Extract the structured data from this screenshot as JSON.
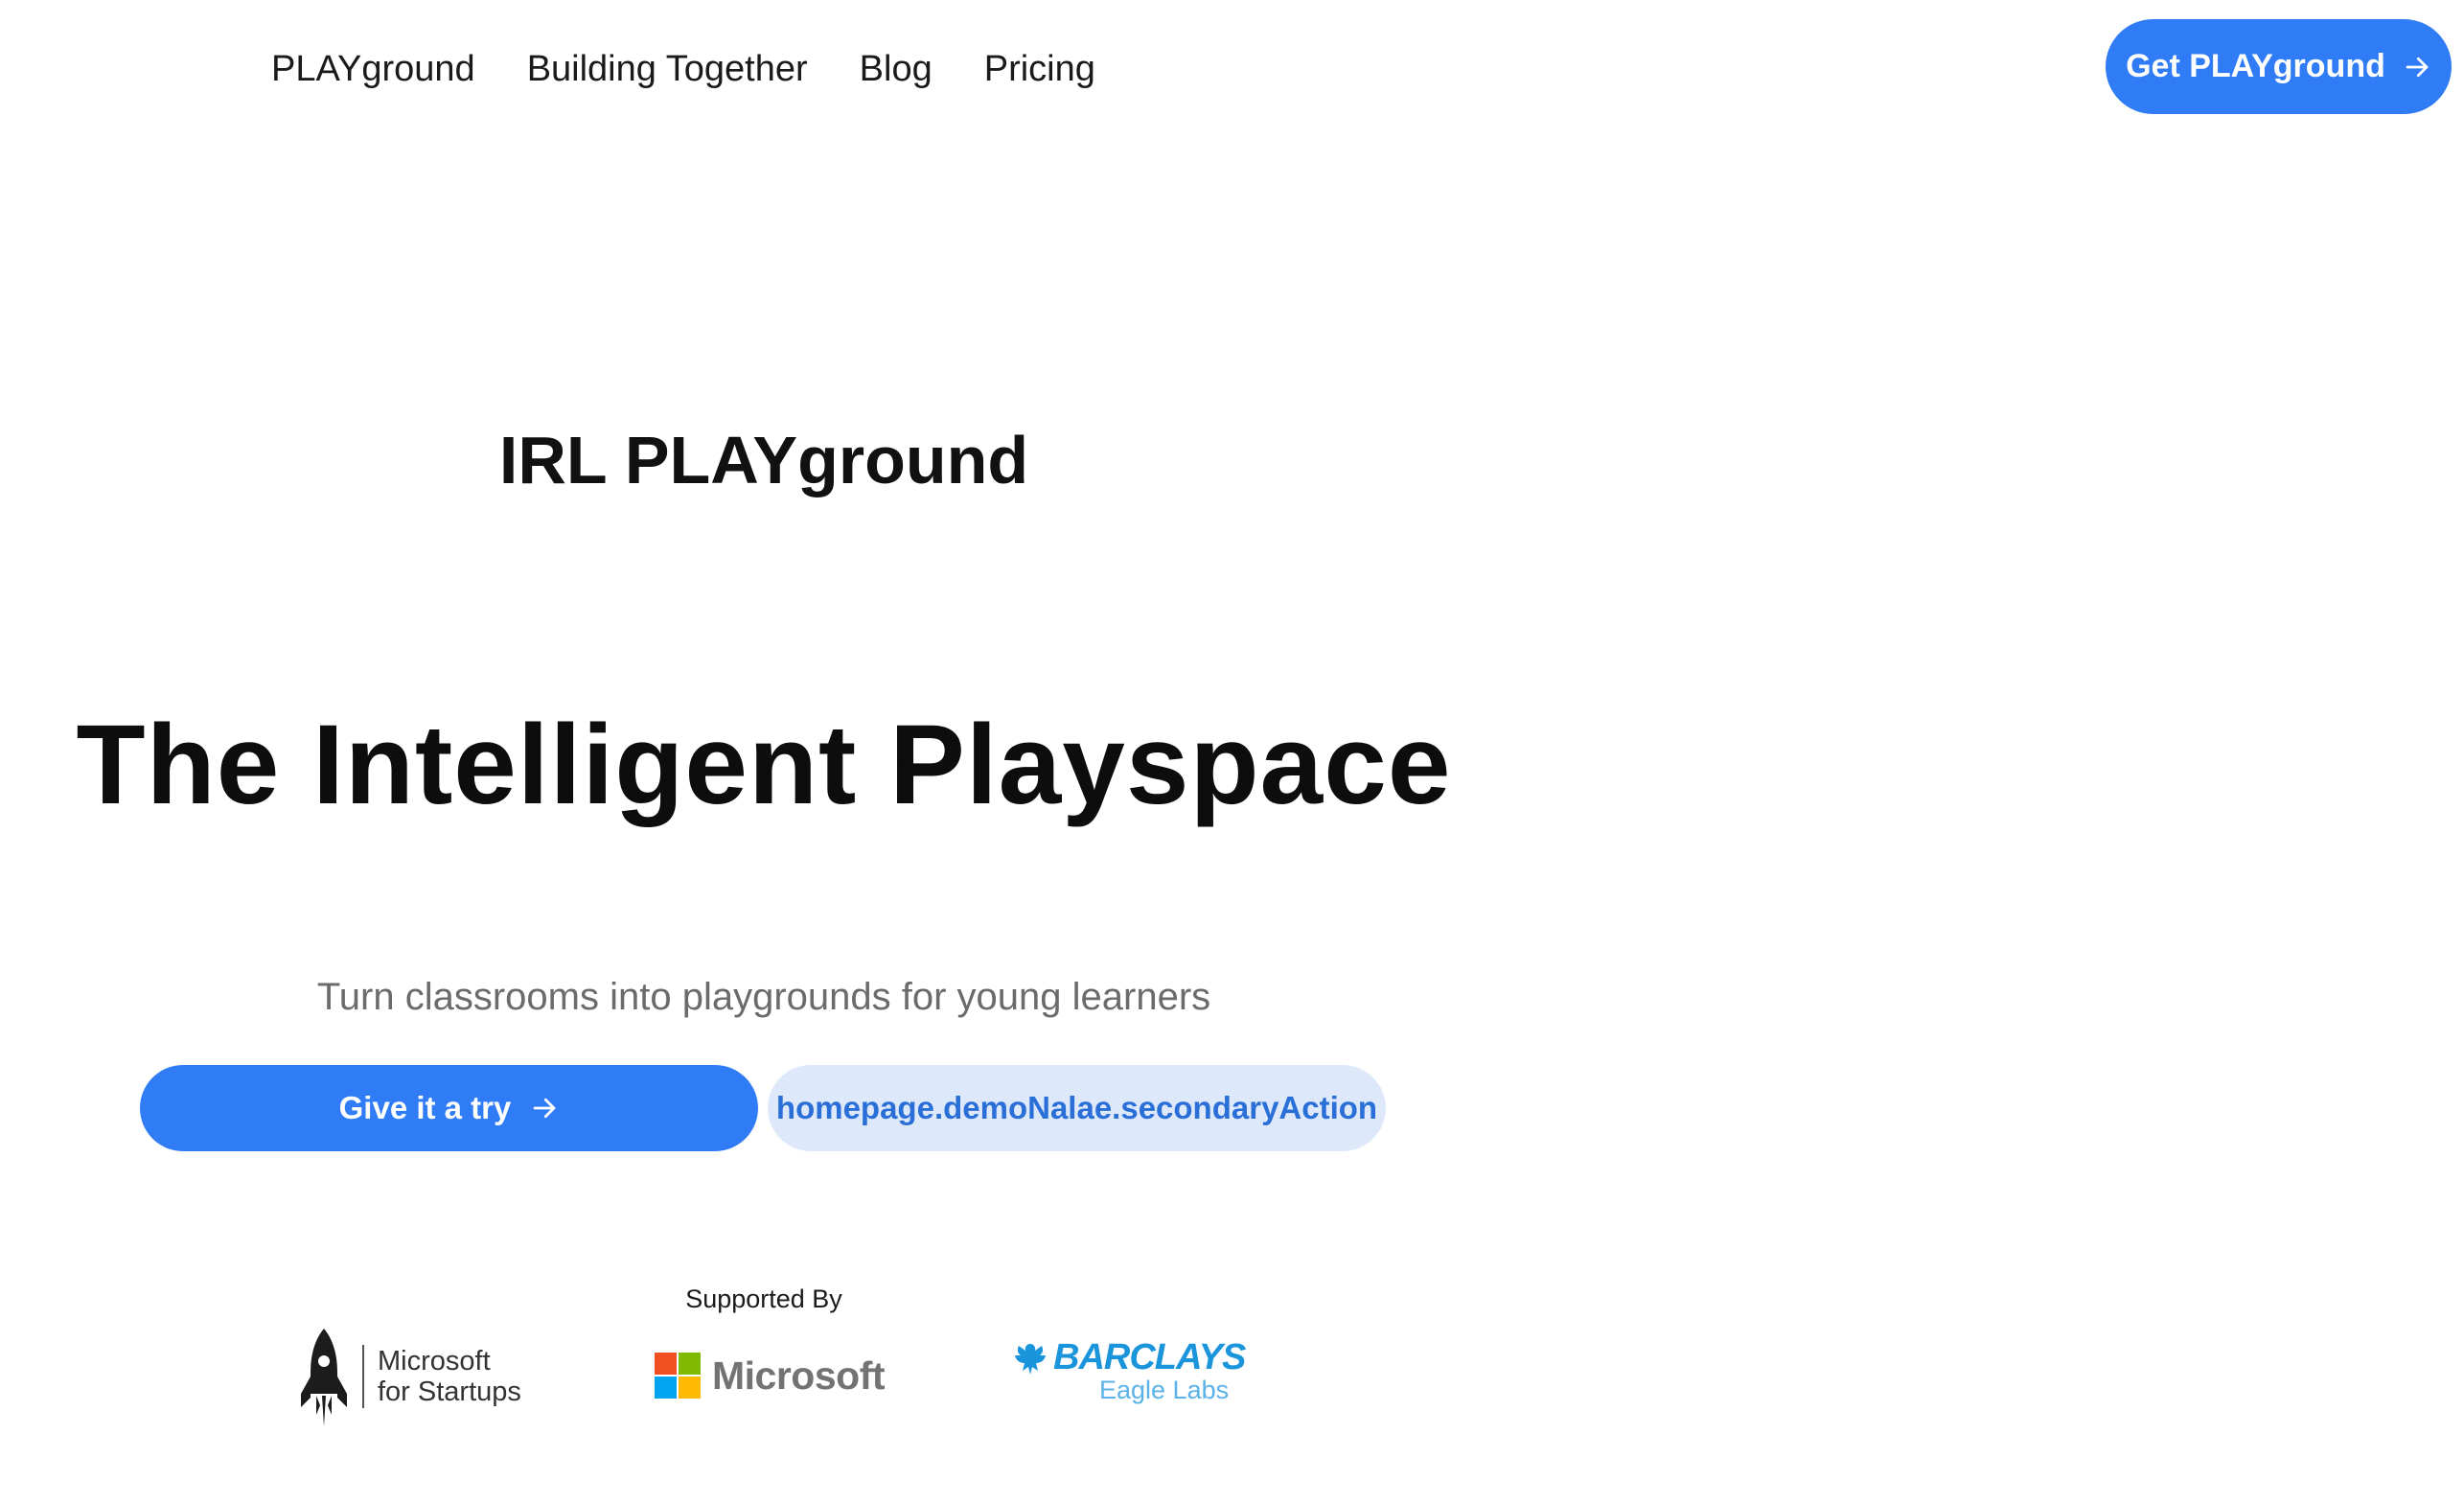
{
  "nav": {
    "items": [
      {
        "label": "PLAYground"
      },
      {
        "label": "Building Together"
      },
      {
        "label": "Blog"
      },
      {
        "label": "Pricing"
      }
    ],
    "cta_label": "Get PLAYground"
  },
  "hero": {
    "brand": "IRL PLAYground",
    "title": "The Intelligent Playspace",
    "subtitle": "Turn classrooms into playgrounds for young learners",
    "primary_action": "Give it a try",
    "secondary_action": "homepage.demoNalae.secondaryAction"
  },
  "supporters": {
    "heading": "Supported By",
    "logos": [
      {
        "icon": "rocket-icon",
        "line1": "Microsoft",
        "line2": "for Startups"
      },
      {
        "icon": "microsoft-squares-icon",
        "name": "Microsoft"
      },
      {
        "icon": "eagle-icon",
        "name": "BARCLAYS",
        "sub": "Eagle Labs"
      }
    ]
  },
  "colors": {
    "accent": "#2f7cf6",
    "secondary_bg": "#dde9fb",
    "secondary_text": "#2a6fd8",
    "subtitle": "#6b6b6b",
    "barclays_blue": "#1a95dc"
  }
}
